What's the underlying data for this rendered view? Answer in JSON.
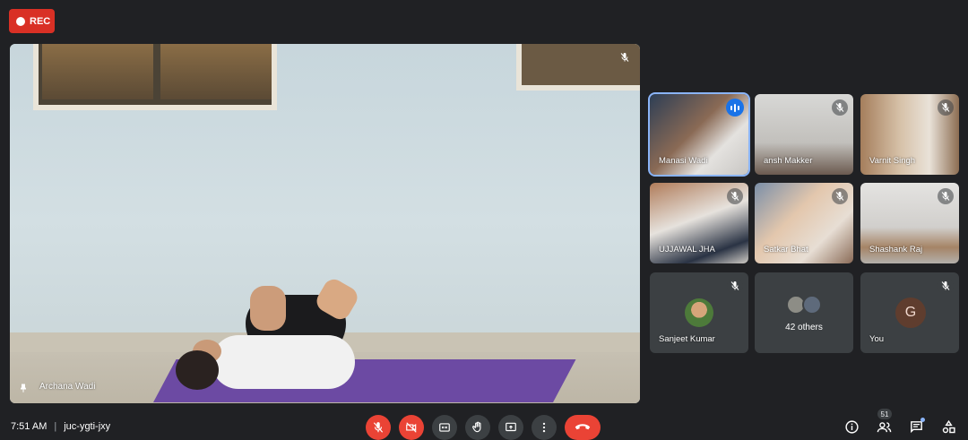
{
  "recording": {
    "label": "REC"
  },
  "main_video": {
    "participant_name": "Archana Wadi"
  },
  "participants": [
    {
      "name": "Manasi Wadi",
      "speaking": true
    },
    {
      "name": "ansh Makker",
      "muted": true
    },
    {
      "name": "Varnit Singh",
      "muted": true
    },
    {
      "name": "UJJAWAL JHA",
      "muted": true
    },
    {
      "name": "Satkar Bhat",
      "muted": true
    },
    {
      "name": "Shashank Raj",
      "muted": true
    },
    {
      "name": "Sanjeet Kumar",
      "muted": true
    },
    {
      "name": "42 others"
    },
    {
      "name": "You",
      "avatar_initial": "G",
      "muted": true
    }
  ],
  "footer": {
    "time": "7:51 AM",
    "separator": "|",
    "meeting_code": "juc-ygti-jxy",
    "people_count": "51"
  },
  "colors": {
    "end_call": "#ea4335",
    "active_speaker": "#1a73e8",
    "rec": "#d93025"
  }
}
